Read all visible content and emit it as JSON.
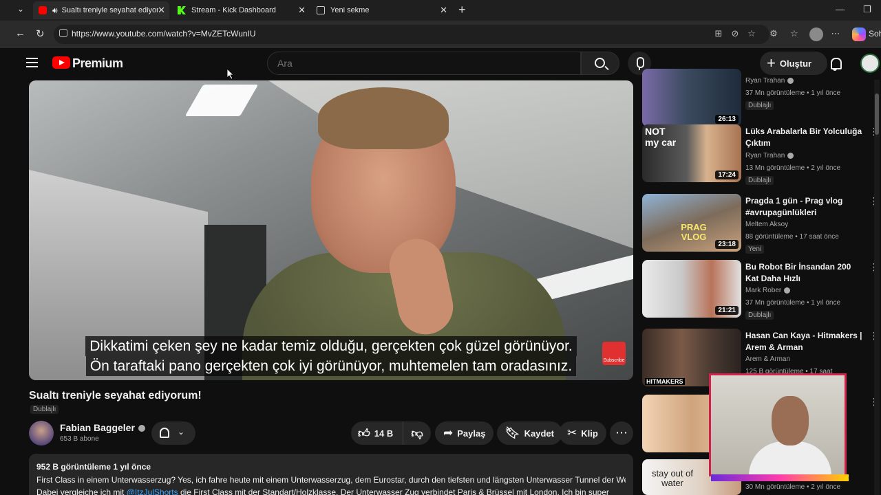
{
  "browser": {
    "tabs": [
      {
        "title": "Sualtı treniyle seyahat ediyorum",
        "icon": "youtube-icon",
        "active": true
      },
      {
        "title": "Stream - Kick Dashboard",
        "icon": "kick-icon",
        "active": false
      },
      {
        "title": "Yeni sekme",
        "icon": "newtab-icon",
        "active": false
      }
    ],
    "url": "https://www.youtube.com/watch?v=MvZETcWunIU",
    "sidebar_label": "Soh"
  },
  "header": {
    "brand": "Premium",
    "search_placeholder": "Ara",
    "create_label": "Oluştur"
  },
  "video": {
    "subtitle_line1": "Dikkatimi çeken şey ne kadar temiz olduğu, gerçekten çok güzel görünüyor.",
    "subtitle_line2": "Ön taraftaki pano gerçekten çok iyi görünüyor, muhtemelen tam oradasınız.",
    "watermark": "Subscribe",
    "title": "Sualtı treniyle seyahat ediyorum!",
    "dub_label": "Dublajlı",
    "channel": "Fabian Baggeler",
    "subscribers": "653 B abone",
    "likes": "14 B",
    "share_label": "Paylaş",
    "save_label": "Kaydet",
    "clip_label": "Klip",
    "description": {
      "meta": "952 B görüntüleme  1 yıl önce",
      "line1": "First Class in einem Unterwasserzug? Yes, ich fahre heute mit einem Unterwasserzug, dem Eurostar, durch den tiefsten und längsten Unterwasser Tunnel der Welt.",
      "line2_pre": "Dabei vergleiche ich mit ",
      "mention": "@ItzJulShorts",
      "line2_post": " die First Class mit der Standart/Holzklasse. Der Unterwasser Zug verbindet Paris & Brüssel mit London. Ich bin super"
    }
  },
  "recommendations": [
    {
      "title": "",
      "channel": "Ryan Trahan",
      "views": "37 Mn görüntüleme • 1 yıl önce",
      "tag": "Dublajlı",
      "duration": "26:13"
    },
    {
      "title": "Lüks Arabalarla Bir Yolculuğa Çıktım",
      "channel": "Ryan Trahan",
      "views": "13 Mn görüntüleme • 2 yıl önce",
      "tag": "Dublajlı",
      "duration": "17:24"
    },
    {
      "title": "Pragda 1 gün - Prag vlog #avrupagünlükleri",
      "channel": "Meltem Aksoy",
      "views": "88 görüntüleme • 17 saat önce",
      "tag": "Yeni",
      "duration": "23:18"
    },
    {
      "title": "Bu Robot Bir İnsandan 200 Kat Daha Hızlı",
      "channel": "Mark Rober",
      "views": "37 Mn görüntüleme • 1 yıl önce",
      "tag": "Dublajlı",
      "duration": "21:21"
    },
    {
      "title": "Hasan Can Kaya - Hitmakers | Arem & Arman",
      "channel": "Arem & Arman",
      "views": "125 B görüntüleme • 17 saat önce",
      "tag": "",
      "duration": ""
    },
    {
      "title": "",
      "channel": "",
      "views": "",
      "tag": "",
      "duration": ""
    },
    {
      "title": "",
      "channel": "",
      "views": "30 Mn görüntüleme • 2 yıl önce",
      "tag": "",
      "duration": ""
    }
  ],
  "thumb_text": {
    "r2": "NOT my car",
    "r3": "PRAG VLOG",
    "r5": "HITMAKERS",
    "r7": "stay out of water"
  }
}
